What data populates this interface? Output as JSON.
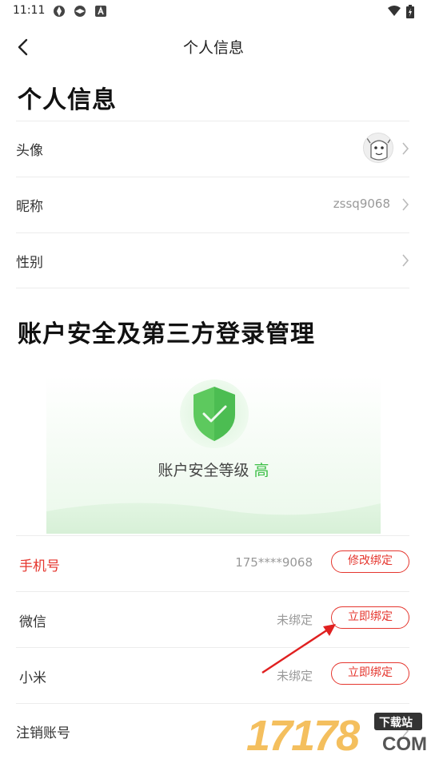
{
  "status_bar": {
    "time": "11:11",
    "icons": [
      "app-icon",
      "app-icon",
      "a-badge-icon"
    ],
    "right_icons": [
      "wifi-icon",
      "battery-icon"
    ]
  },
  "nav": {
    "back_icon": "chevron-left-icon",
    "title": "个人信息"
  },
  "personal": {
    "heading": "个人信息",
    "rows": [
      {
        "label": "头像",
        "value": "",
        "kind": "avatar"
      },
      {
        "label": "昵称",
        "value": "zssq9068",
        "kind": "text"
      },
      {
        "label": "性别",
        "value": "",
        "kind": "text"
      }
    ]
  },
  "security": {
    "heading": "账户安全及第三方登录管理",
    "level_label": "账户安全等级",
    "level_value": "高",
    "level_color": "#3cbf46",
    "shield_icon": "shield-check-icon"
  },
  "accounts": [
    {
      "label": "手机号",
      "value": "175****9068",
      "button": "修改绑定",
      "highlight": true
    },
    {
      "label": "微信",
      "value": "未绑定",
      "button": "立即绑定",
      "highlight": false
    },
    {
      "label": "小米",
      "value": "未绑定",
      "button": "立即绑定",
      "highlight": false
    },
    {
      "label": "注销账号",
      "value": "",
      "button": "",
      "highlight": false
    }
  ],
  "watermark": {
    "number": "17178",
    "tag": "下载站",
    "domain": "COM"
  },
  "colors": {
    "accent_red": "#e5362e",
    "green": "#3cbf46"
  }
}
